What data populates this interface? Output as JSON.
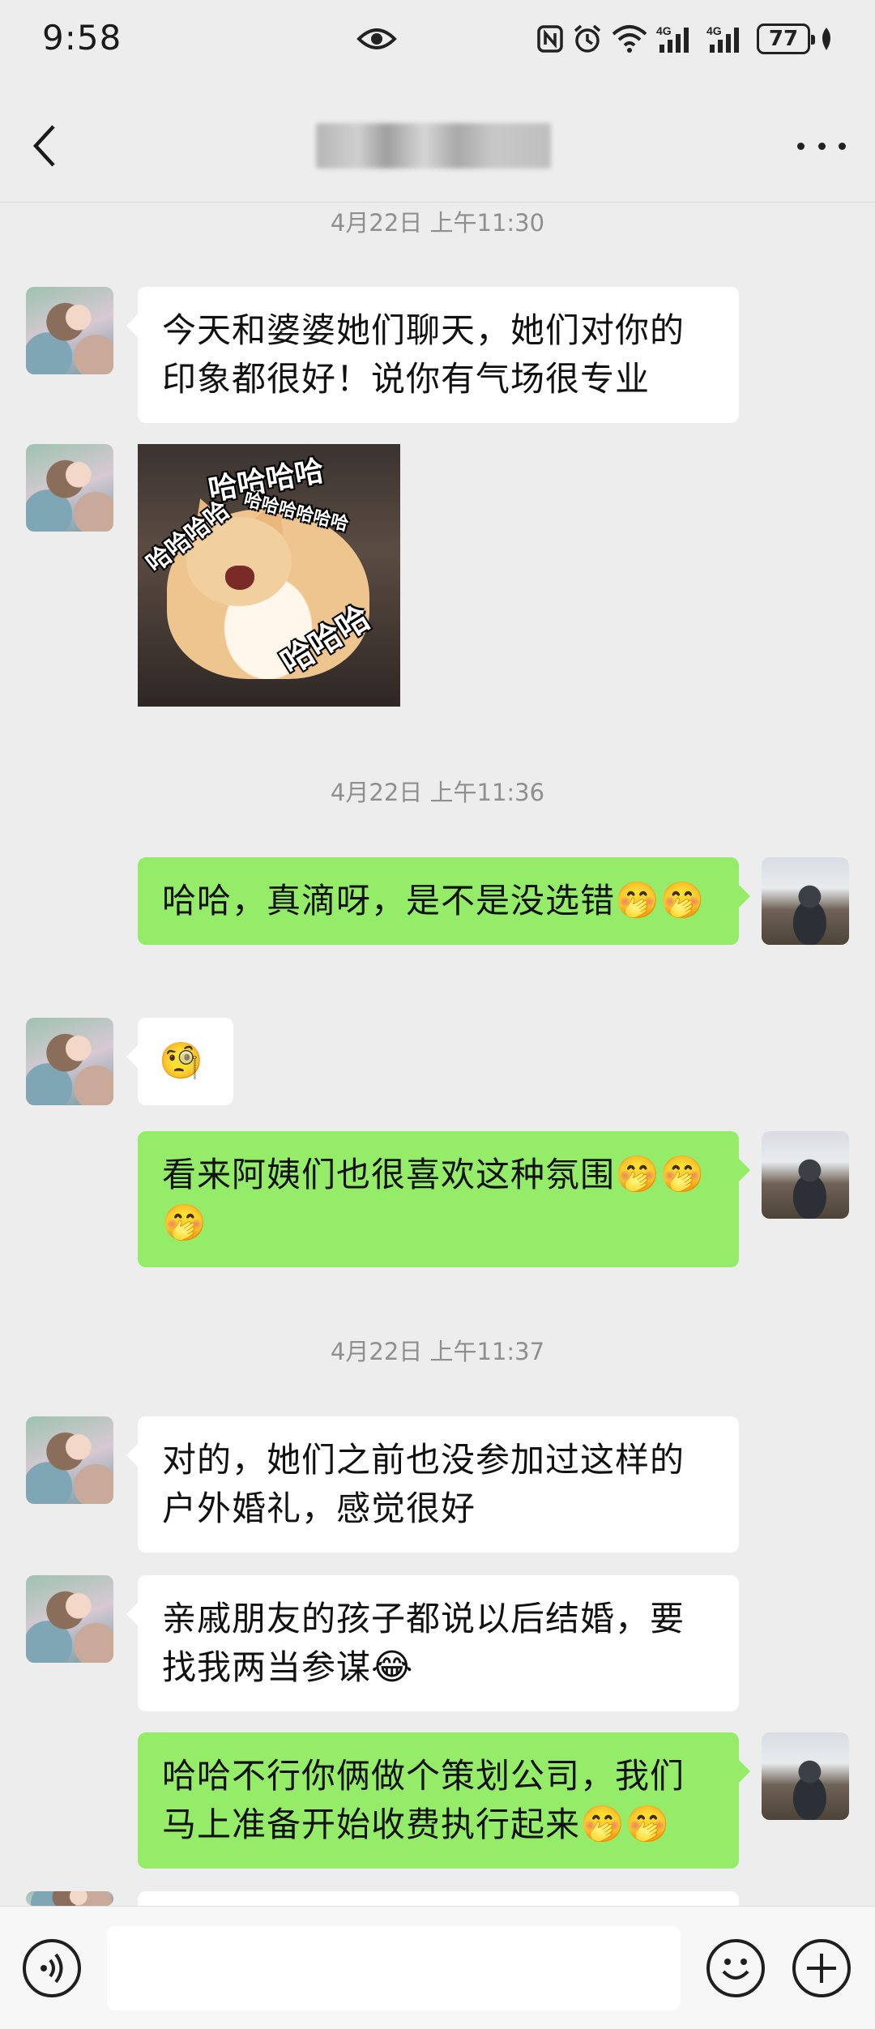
{
  "status_bar": {
    "time": "9:58",
    "battery": "77",
    "icons": [
      "eye-icon",
      "nfc-icon",
      "alarm-icon",
      "wifi-icon",
      "signal-4g-icon",
      "signal-4g-icon",
      "battery-icon",
      "leaf-icon"
    ]
  },
  "header": {
    "title": "",
    "back_icon": "chevron-left-icon",
    "more_icon": "more-dots-icon"
  },
  "messages": [
    {
      "type": "timestamp",
      "text": "4月22日 上午11:30"
    },
    {
      "type": "text",
      "side": "left",
      "text": "今天和婆婆她们聊天，她们对你的印象都很好！说你有气场很专业"
    },
    {
      "type": "image",
      "side": "left",
      "overlay_text": [
        "哈哈哈哈",
        "哈哈哈哈",
        "哈哈哈哈哈哈",
        "哈哈哈"
      ]
    },
    {
      "type": "timestamp",
      "text": "4月22日 上午11:36"
    },
    {
      "type": "text",
      "side": "right",
      "text": "哈哈，真滴呀，是不是没选错",
      "emoji": "🤭🤭"
    },
    {
      "type": "text",
      "side": "left",
      "text": "",
      "emoji": "🧐"
    },
    {
      "type": "text",
      "side": "right",
      "text": "看来阿姨们也很喜欢这种氛围",
      "emoji": "🤭🤭🤭"
    },
    {
      "type": "timestamp",
      "text": "4月22日 上午11:37"
    },
    {
      "type": "text",
      "side": "left",
      "text": "对的，她们之前也没参加过这样的户外婚礼，感觉很好"
    },
    {
      "type": "text",
      "side": "left",
      "text": "亲戚朋友的孩子都说以后结婚，要找我两当参谋",
      "emoji": "😂"
    },
    {
      "type": "text",
      "side": "right",
      "text": "哈哈不行你俩做个策划公司，我们马上准备开始收费执行起来",
      "emoji": "🤭🤭"
    }
  ],
  "input_bar": {
    "voice_icon": "voice-icon",
    "emoji_icon": "emoji-icon",
    "plus_icon": "plus-icon",
    "value": ""
  }
}
